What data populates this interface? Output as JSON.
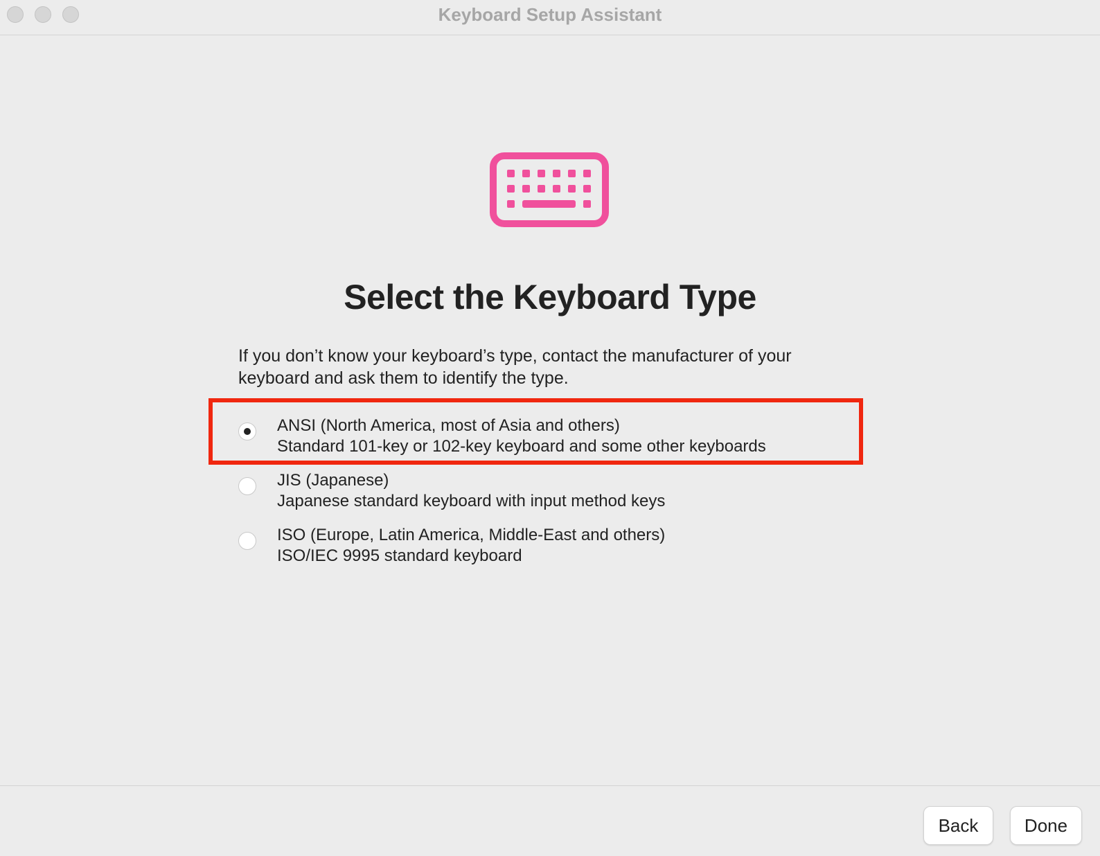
{
  "window": {
    "title": "Keyboard Setup Assistant"
  },
  "icon": {
    "name": "keyboard-icon",
    "color": "#f0509c"
  },
  "main": {
    "heading": "Select the Keyboard Type",
    "description_line1": "If you don’t know your keyboard’s type, contact the manufacturer of your",
    "description_line2": "keyboard and ask them to identify the type."
  },
  "options": [
    {
      "label": "ANSI (North America, most of Asia and others)",
      "sub": "Standard 101-key or 102-key keyboard and some other keyboards",
      "selected": true
    },
    {
      "label": "JIS (Japanese)",
      "sub": "Japanese standard keyboard with input method keys",
      "selected": false
    },
    {
      "label": "ISO (Europe, Latin America, Middle-East and others)",
      "sub": "ISO/IEC 9995 standard keyboard",
      "selected": false
    }
  ],
  "highlight_color": "#f0270f",
  "buttons": {
    "back": "Back",
    "done": "Done"
  }
}
